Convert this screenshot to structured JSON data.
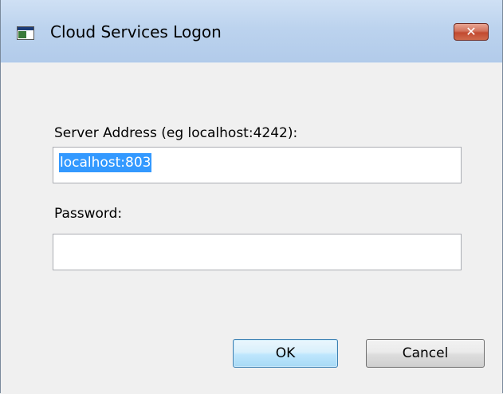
{
  "window": {
    "title": "Cloud Services Logon",
    "close_glyph": "✕"
  },
  "form": {
    "server_label": "Server Address (eg localhost:4242):",
    "server_value": "localhost:803",
    "password_label": "Password:",
    "password_value": ""
  },
  "buttons": {
    "ok_label": "OK",
    "cancel_label": "Cancel"
  },
  "colors": {
    "selection": "#3399ff",
    "titlebar": "#bcd3ee",
    "close_button": "#c24a30",
    "default_button_border": "#3c7fb1"
  },
  "icons": {
    "app_icon": "app-window-icon",
    "close_icon": "close-icon"
  }
}
